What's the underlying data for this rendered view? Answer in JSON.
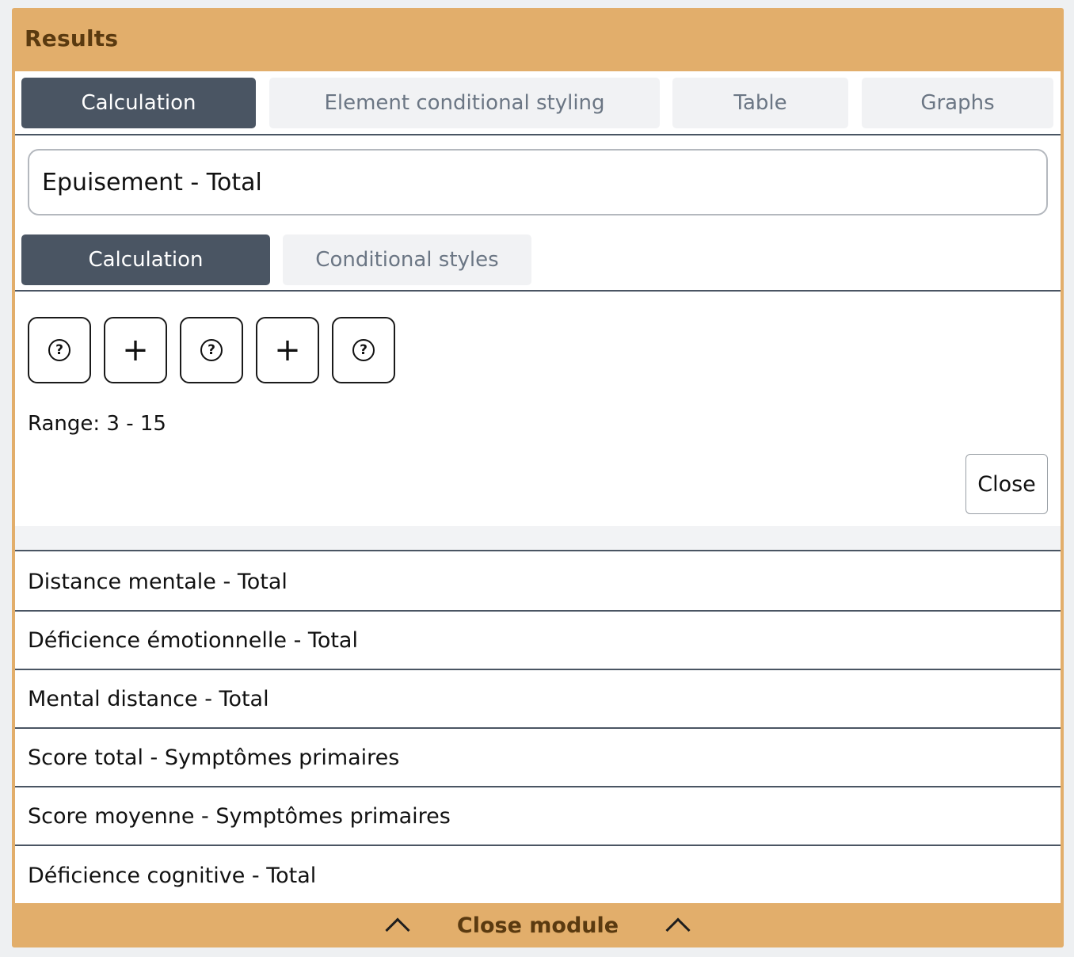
{
  "module": {
    "title": "Results",
    "close_label": "Close module"
  },
  "main_tabs": [
    {
      "label": "Calculation",
      "active": true
    },
    {
      "label": "Element conditional styling",
      "active": false
    },
    {
      "label": "Table",
      "active": false
    },
    {
      "label": "Graphs",
      "active": false
    }
  ],
  "element": {
    "name_value": "Epuisement - Total"
  },
  "sub_tabs": [
    {
      "label": "Calculation",
      "active": true
    },
    {
      "label": "Conditional styles",
      "active": false
    }
  ],
  "tokens": [
    {
      "icon": "question-circle-icon"
    },
    {
      "icon": "plus-icon"
    },
    {
      "icon": "question-circle-icon"
    },
    {
      "icon": "plus-icon"
    },
    {
      "icon": "question-circle-icon"
    }
  ],
  "range_text": "Range: 3 - 15",
  "close_button": "Close",
  "list_items": [
    "Distance mentale - Total",
    "Déficience émotionnelle - Total",
    "Mental distance - Total",
    "Score total - Symptômes primaires",
    "Score moyenne - Symptômes primaires",
    "Déficience cognitive - Total"
  ],
  "colors": {
    "module_accent": "#e2ae6b",
    "active_tab": "#4a5563",
    "inactive_tab": "#f1f2f4"
  }
}
